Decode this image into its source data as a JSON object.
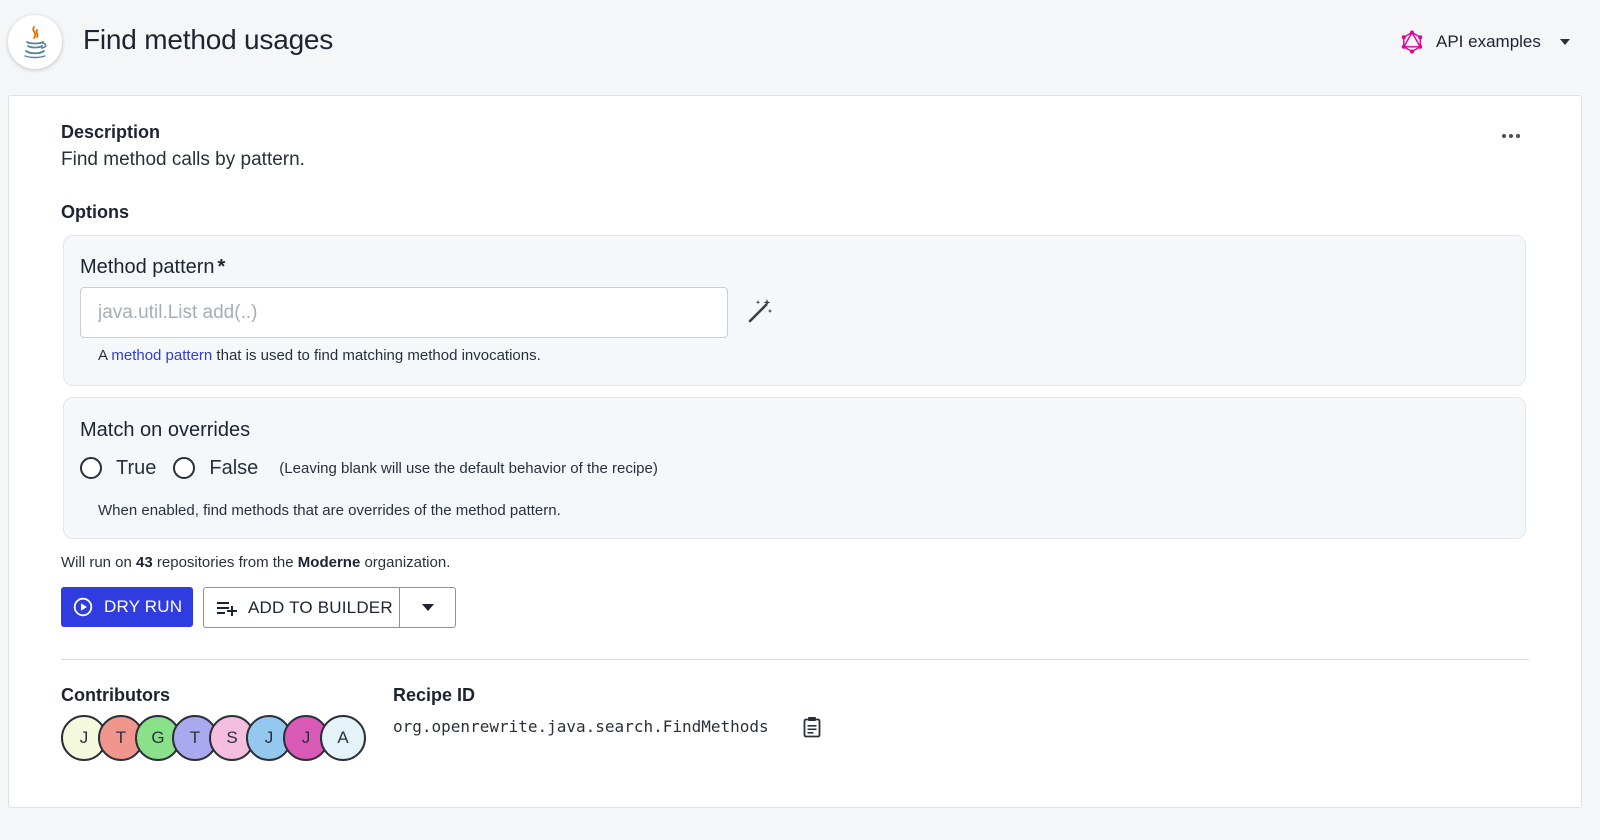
{
  "header": {
    "title": "Find method usages",
    "logo_icon": "java-icon",
    "api_selector": {
      "label": "API examples",
      "icon": "graphql-icon",
      "accent": "#e10098"
    }
  },
  "description": {
    "heading": "Description",
    "text": "Find method calls by pattern."
  },
  "options": {
    "heading": "Options",
    "method_pattern": {
      "label": "Method pattern",
      "required_marker": "*",
      "value": "",
      "placeholder": "java.util.List add(..)",
      "helper_prefix": "A ",
      "helper_link": "method pattern",
      "helper_suffix": " that is used to find matching method invocations."
    },
    "match_overrides": {
      "label": "Match on overrides",
      "choices": [
        "True",
        "False"
      ],
      "selected": null,
      "note": "(Leaving blank will use the default behavior of the recipe)",
      "helper": "When enabled, find methods that are overrides of the method pattern."
    }
  },
  "run": {
    "prefix": "Will run on ",
    "count": "43",
    "middle": " repositories from the ",
    "org": "Moderne",
    "suffix": " organization."
  },
  "actions": {
    "dry_run": "DRY RUN",
    "add_to_builder": "ADD TO BUILDER",
    "primary_color": "#2f3de0"
  },
  "contributors": {
    "heading": "Contributors",
    "avatars": [
      {
        "initial": "J",
        "color": "#f4f8dc"
      },
      {
        "initial": "T",
        "color": "#f0968d"
      },
      {
        "initial": "G",
        "color": "#8be08a"
      },
      {
        "initial": "T",
        "color": "#aaa8ee"
      },
      {
        "initial": "S",
        "color": "#f6bede"
      },
      {
        "initial": "J",
        "color": "#95c8ee"
      },
      {
        "initial": "J",
        "color": "#d85ab6"
      },
      {
        "initial": "A",
        "color": "#e3f3f8"
      }
    ]
  },
  "recipe": {
    "heading": "Recipe ID",
    "id": "org.openrewrite.java.search.FindMethods"
  }
}
